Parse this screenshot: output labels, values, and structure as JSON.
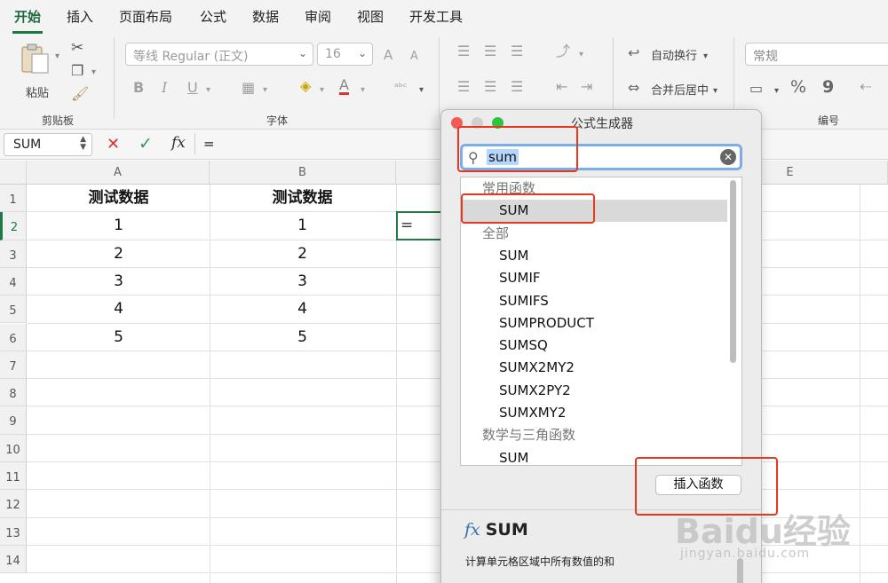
{
  "ribbon": {
    "tabs": [
      "开始",
      "插入",
      "页面布局",
      "公式",
      "数据",
      "审阅",
      "视图",
      "开发工具"
    ],
    "active_tab": "开始",
    "clipboard": {
      "paste_label": "粘贴",
      "group_label": "剪贴板"
    },
    "font": {
      "name": "等线 Regular (正文)",
      "size": "16",
      "group_label": "字体",
      "bold": "B",
      "italic": "I",
      "underline": "U",
      "grow": "A",
      "shrink": "A"
    },
    "alignment": {
      "wrap_text": "自动换行",
      "merge_center": "合并后居中"
    },
    "number": {
      "format": "常规",
      "group_label": "编号",
      "percent": "%",
      "comma": "9"
    },
    "icons": [
      "paste-icon",
      "cut-icon",
      "copy-icon",
      "format-painter-icon",
      "borders-icon",
      "fill-color-icon",
      "font-color-icon",
      "phonetic-icon",
      "align-icon",
      "indent-icon",
      "wrap-icon",
      "merge-icon",
      "currency-icon"
    ]
  },
  "formula_bar": {
    "name_box": "SUM",
    "cancel": "✕",
    "enter": "✓",
    "fx": "fx",
    "content": "="
  },
  "grid": {
    "columns": [
      "A",
      "B",
      "",
      "",
      "E"
    ],
    "rows": [
      "1",
      "2",
      "3",
      "4",
      "5",
      "6",
      "7",
      "8",
      "9",
      "10",
      "11",
      "12",
      "13",
      "14"
    ],
    "header_row": [
      "测试数据",
      "测试数据"
    ],
    "data": [
      [
        "1",
        "1"
      ],
      [
        "2",
        "2"
      ],
      [
        "3",
        "3"
      ],
      [
        "4",
        "4"
      ],
      [
        "5",
        "5"
      ]
    ],
    "active_cell_value": "="
  },
  "dialog": {
    "title": "公式生成器",
    "search_value": "sum",
    "list": [
      {
        "label": "常用函数",
        "kind": "cat"
      },
      {
        "label": "SUM",
        "kind": "fn",
        "selected": true
      },
      {
        "label": "全部",
        "kind": "cat"
      },
      {
        "label": "SUM",
        "kind": "fn"
      },
      {
        "label": "SUMIF",
        "kind": "fn"
      },
      {
        "label": "SUMIFS",
        "kind": "fn"
      },
      {
        "label": "SUMPRODUCT",
        "kind": "fn"
      },
      {
        "label": "SUMSQ",
        "kind": "fn"
      },
      {
        "label": "SUMX2MY2",
        "kind": "fn"
      },
      {
        "label": "SUMX2PY2",
        "kind": "fn"
      },
      {
        "label": "SUMXMY2",
        "kind": "fn"
      },
      {
        "label": "数学与三角函数",
        "kind": "cat"
      },
      {
        "label": "SUM",
        "kind": "fn"
      }
    ],
    "insert_button": "插入函数",
    "func_name": "SUM",
    "fx": "fx",
    "func_desc": "计算单元格区域中所有数值的和"
  },
  "watermark": {
    "logo": "Baidu经验",
    "url": "jingyan.baidu.com"
  },
  "colors": {
    "accent": "#1d7a45",
    "annotation": "#e8371f",
    "selection_blue": "#7aaee9"
  }
}
